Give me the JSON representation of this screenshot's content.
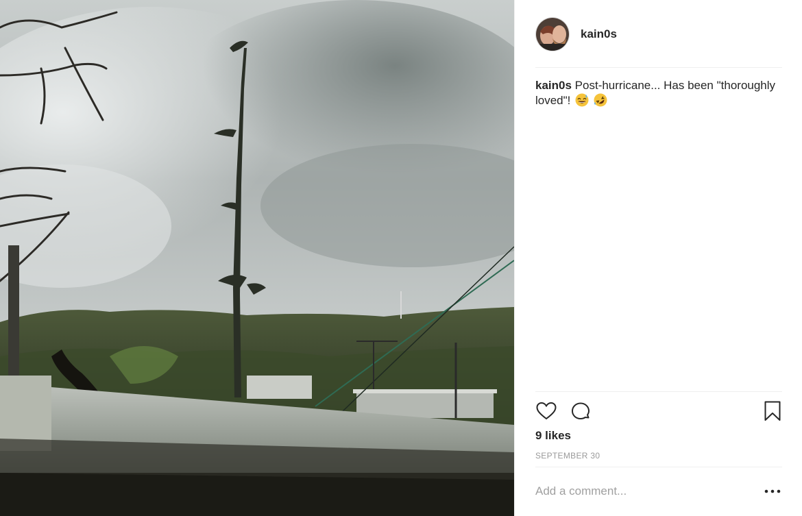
{
  "post": {
    "author": {
      "username": "kain0s",
      "avatar_icon": "profile-photo-avatar"
    },
    "caption": {
      "username": "kain0s",
      "text": "Post-hurricane... Has been \"thoroughly loved\"!",
      "emojis": [
        "grinning-sweat-emoji",
        "rolling-laughing-emoji"
      ]
    },
    "photo": {
      "description_icon": "post-photo"
    },
    "actions": {
      "like_icon": "heart-icon",
      "comment_icon": "comment-icon",
      "save_icon": "bookmark-icon"
    },
    "likes": "9 likes",
    "date": "SEPTEMBER 30",
    "comment_box": {
      "placeholder": "Add a comment...",
      "more_icon": "more-options-icon"
    }
  },
  "colors": {
    "text": "#262626",
    "muted": "#999999",
    "divider": "#efefef",
    "emoji_yellow": "#f5c33b"
  }
}
